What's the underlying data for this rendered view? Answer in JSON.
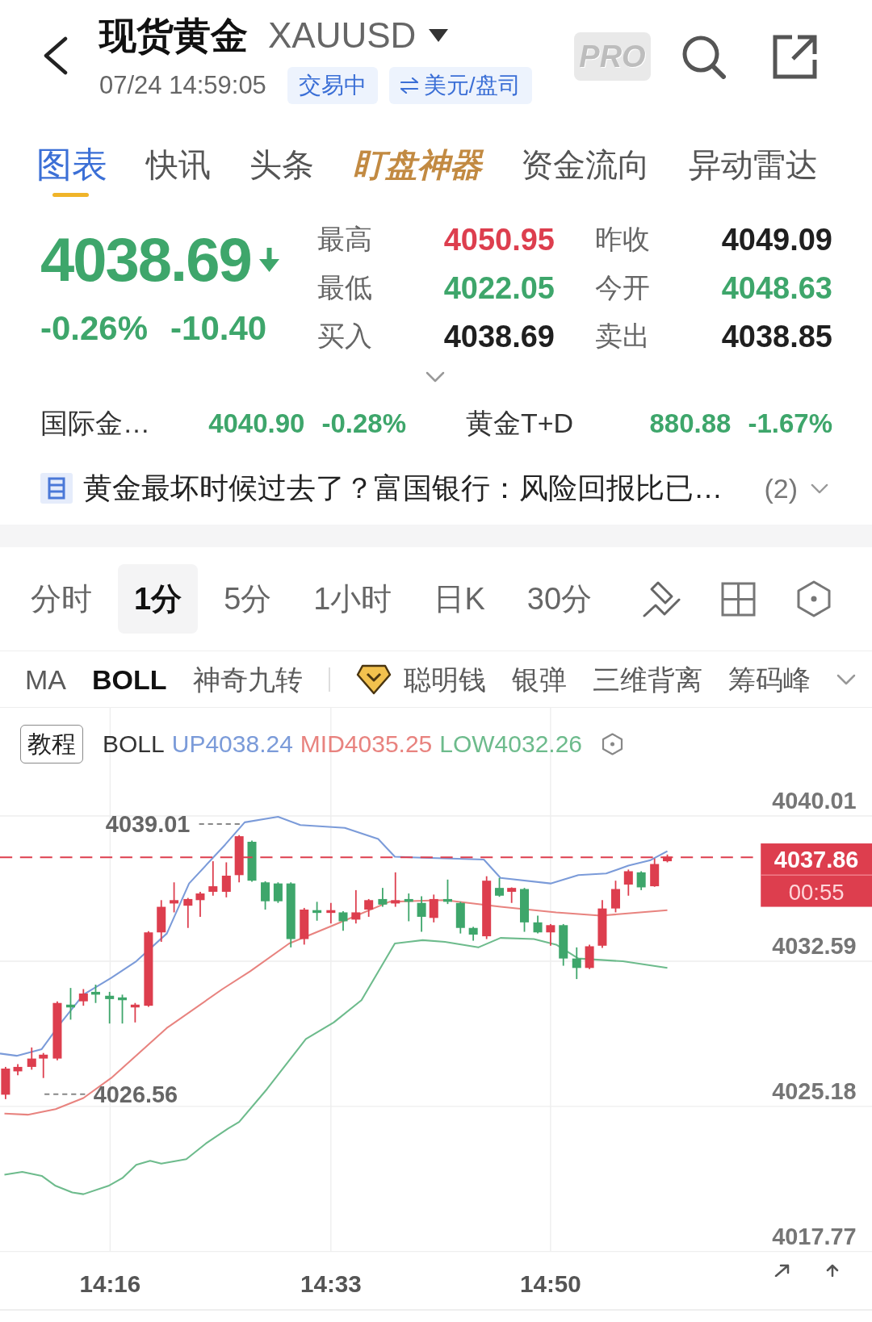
{
  "header": {
    "title": "现货黄金",
    "symbol": "XAUUSD",
    "time": "07/24 14:59:05",
    "badges": [
      {
        "kind": "status",
        "label": "交易中"
      },
      {
        "kind": "currency",
        "label": "美元/盘司"
      }
    ],
    "pro_label": "PRO"
  },
  "tabs": [
    {
      "label": "图表",
      "kind": "plain",
      "selected": true
    },
    {
      "label": "快讯",
      "kind": "plain",
      "selected": false
    },
    {
      "label": "头条",
      "kind": "plain",
      "selected": false
    },
    {
      "label": "盯盘神器",
      "kind": "featured",
      "selected": false
    },
    {
      "label": "资金流向",
      "kind": "plain",
      "selected": false
    },
    {
      "label": "异动雷达",
      "kind": "plain",
      "selected": false
    }
  ],
  "quote": {
    "price": "4038.69",
    "falling": true,
    "change_percent": "-0.26%",
    "change": "-10.40",
    "stats": [
      {
        "label": "最高",
        "value": "4050.95",
        "color": "#dd3e4e"
      },
      {
        "label": "昨收",
        "value": "4049.09",
        "color": "#1f1f1f"
      },
      {
        "label": "最低",
        "value": "4022.05",
        "color": "#3ea66b"
      },
      {
        "label": "今开",
        "value": "4048.63",
        "color": "#3ea66b"
      },
      {
        "label": "买入",
        "value": "4038.69",
        "color": "#1f1f1f"
      },
      {
        "label": "卖出",
        "value": "4038.85",
        "color": "#1f1f1f"
      }
    ]
  },
  "related": [
    {
      "name": "国际金…",
      "price": "4040.90",
      "change": "-0.28%",
      "color": "#3ea66b"
    },
    {
      "name": "黄金T+D",
      "price": "880.88",
      "change": "-1.67%",
      "color": "#3ea66b"
    }
  ],
  "news": {
    "headline": "黄金最坏时候过去了？富国银行：风险回报比已…",
    "count": "(2)"
  },
  "periods": [
    {
      "label": "分时",
      "selected": false
    },
    {
      "label": "1分",
      "selected": true
    },
    {
      "label": "5分",
      "selected": false
    },
    {
      "label": "1小时",
      "selected": false
    },
    {
      "label": "日K",
      "selected": false
    },
    {
      "label": "30分",
      "selected": false
    }
  ],
  "indicators": [
    {
      "label": "MA",
      "kind": "plain",
      "selected": false
    },
    {
      "label": "BOLL",
      "kind": "plain",
      "selected": true
    },
    {
      "label": "神奇九转",
      "kind": "plain",
      "selected": false
    },
    {
      "label": "聪明钱",
      "kind": "premium",
      "selected": false
    },
    {
      "label": "银弹",
      "kind": "plain",
      "selected": false
    },
    {
      "label": "三维背离",
      "kind": "plain",
      "selected": false
    },
    {
      "label": "筹码峰",
      "kind": "plain",
      "selected": false
    }
  ],
  "chart": {
    "tutorial_label": "教程",
    "indicator": "BOLL",
    "bands": [
      {
        "label": "UP4038.24",
        "color": "#7b9bd9"
      },
      {
        "label": "MID4035.25",
        "color": "#e8837f"
      },
      {
        "label": "LOW4032.26",
        "color": "#6dbb8c"
      }
    ],
    "y_axis": [
      "4040.01",
      "4032.59",
      "4025.18",
      "4017.77"
    ],
    "x_axis": [
      "14:16",
      "14:33",
      "14:50"
    ],
    "high_marker": "4039.01",
    "low_marker": "4026.56",
    "last_price": "4037.86",
    "countdown": "00:55"
  }
}
